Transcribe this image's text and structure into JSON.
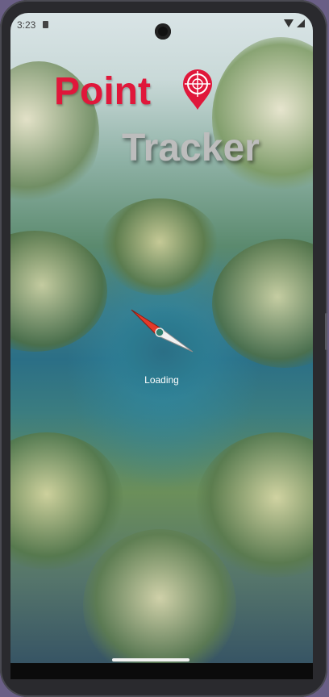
{
  "status_bar": {
    "time": "3:23",
    "icons": [
      "sim-card-icon",
      "wifi-icon",
      "signal-icon"
    ]
  },
  "app": {
    "title_word1": "Point",
    "title_word2": "Tracker",
    "loading_text": "Loading",
    "colors": {
      "title_red": "#e0173a",
      "title_gray": "#bdbdbd",
      "loading_text": "#ffffff"
    },
    "icons": [
      "map-pin-icon",
      "compass-needle-icon"
    ]
  }
}
